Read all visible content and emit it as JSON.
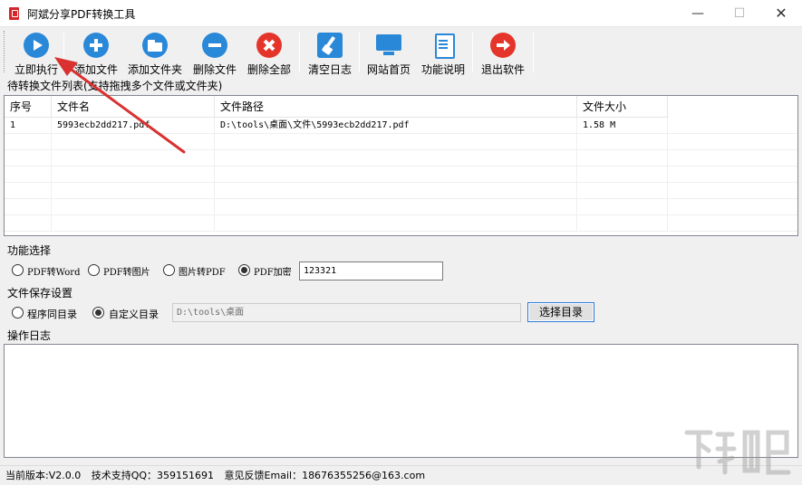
{
  "window": {
    "title": "阿斌分享PDF转换工具",
    "minimize": "—",
    "maximize": "☐",
    "close": "✕"
  },
  "toolbar": {
    "buttons": [
      {
        "label": "立即执行",
        "icon": "play-icon"
      },
      {
        "label": "添加文件",
        "icon": "plus-icon"
      },
      {
        "label": "添加文件夹",
        "icon": "folder-icon"
      },
      {
        "label": "删除文件",
        "icon": "minus-icon"
      },
      {
        "label": "删除全部",
        "icon": "delete-all-icon"
      },
      {
        "label": "清空日志",
        "icon": "broom-icon"
      },
      {
        "label": "网站首页",
        "icon": "monitor-icon"
      },
      {
        "label": "功能说明",
        "icon": "document-icon"
      },
      {
        "label": "退出软件",
        "icon": "exit-icon"
      }
    ]
  },
  "filelist": {
    "label": "待转换文件列表(支持拖拽多个文件或文件夹)",
    "columns": [
      "序号",
      "文件名",
      "文件路径",
      "文件大小"
    ],
    "rows": [
      {
        "index": "1",
        "name": "5993ecb2dd217.pdf",
        "path": "D:\\tools\\桌面\\文件\\5993ecb2dd217.pdf",
        "size": "1.58 M"
      }
    ]
  },
  "function": {
    "label": "功能选择",
    "options": [
      {
        "label": "PDF转Word",
        "selected": false
      },
      {
        "label": "PDF转图片",
        "selected": false
      },
      {
        "label": "图片转PDF",
        "selected": false
      },
      {
        "label": "PDF加密",
        "selected": true
      }
    ],
    "password_value": "123321"
  },
  "save": {
    "label": "文件保存设置",
    "options": [
      {
        "label": "程序同目录",
        "selected": false
      },
      {
        "label": "自定义目录",
        "selected": true
      }
    ],
    "dir_value": "D:\\tools\\桌面",
    "choose_button": "选择目录"
  },
  "log": {
    "label": "操作日志"
  },
  "status": {
    "version": "当前版本:V2.0.0",
    "support": "技术支持QQ：359151691",
    "feedback": "意见反馈Email：18676355256@163.com"
  },
  "colors": {
    "accent": "#2a88d8",
    "danger": "#e5352b",
    "annotation": "#d93030"
  }
}
